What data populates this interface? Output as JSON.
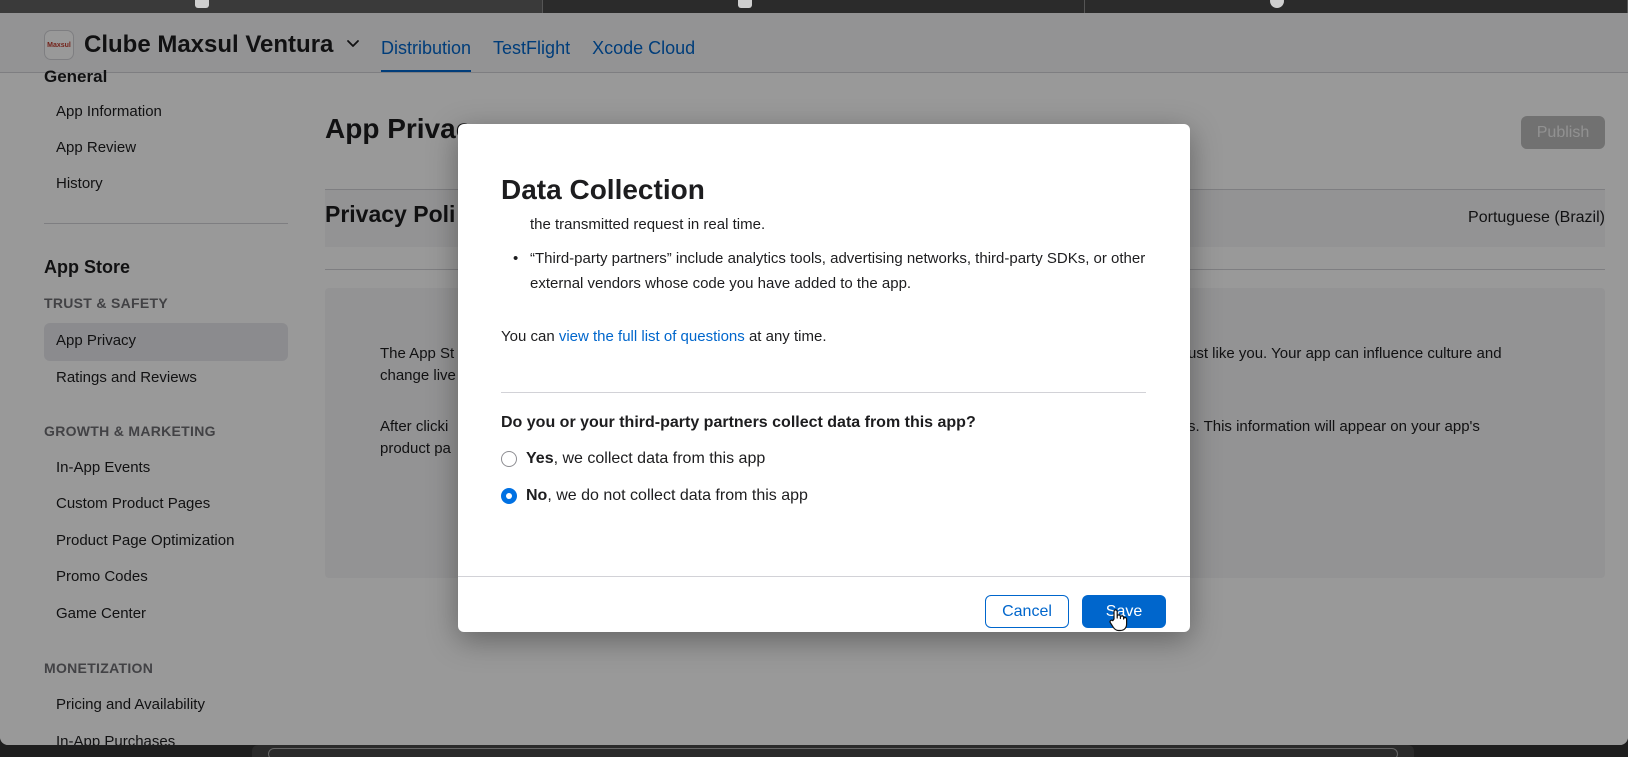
{
  "header": {
    "app_name": "Clube Maxsul Ventura",
    "app_icon_text": "Maxsul",
    "nav": [
      {
        "label": "Distribution",
        "active": true
      },
      {
        "label": "TestFlight",
        "active": false
      },
      {
        "label": "Xcode Cloud",
        "active": false
      }
    ]
  },
  "sidebar": {
    "cut_heading": "General",
    "general_items": [
      "App Information",
      "App Review",
      "History"
    ],
    "store_heading": "App Store",
    "sections": [
      {
        "title": "TRUST & SAFETY",
        "items": [
          "App Privacy",
          "Ratings and Reviews"
        ]
      },
      {
        "title": "GROWTH & MARKETING",
        "items": [
          "In-App Events",
          "Custom Product Pages",
          "Product Page Optimization",
          "Promo Codes",
          "Game Center"
        ]
      },
      {
        "title": "MONETIZATION",
        "items": [
          "Pricing and Availability",
          "In-App Purchases"
        ]
      }
    ],
    "selected_item": "App Privacy"
  },
  "main": {
    "title": "App Privac",
    "publish_label": "Publish",
    "privacy_policy_title": "Privacy Poli",
    "language": "Portuguese (Brazil)",
    "info_left_1a": "The App St",
    "info_left_1b": "change live",
    "info_right_1": "ust like you. Your app can influence culture and",
    "info_left_2a": "After clicki",
    "info_left_2b": "product pa",
    "info_right_2": "s. This information will appear on your app's"
  },
  "modal": {
    "title": "Data Collection",
    "cut_text": "the transmitted request in real time.",
    "bullet_text": "“Third-party partners” include analytics tools, advertising networks, third-party SDKs, or other external vendors whose code you have added to the app.",
    "learn_prefix": "You can ",
    "learn_link": "view the full list of questions",
    "learn_suffix": " at any time.",
    "question": "Do you or your third-party partners collect data from this app?",
    "yes_bold": "Yes",
    "yes_rest": ", we collect data from this app",
    "no_bold": "No",
    "no_rest": ", we do not collect data from this app",
    "selected_option": "No",
    "cancel_label": "Cancel",
    "save_label": "Save"
  },
  "colors": {
    "accent": "#0066cc",
    "radio_selected": "#0071e3",
    "publish_disabled": "#bdbdbd"
  },
  "icons": [
    "app-icon",
    "chevron-down-icon",
    "radio-icon",
    "pointer-hand-icon"
  ]
}
